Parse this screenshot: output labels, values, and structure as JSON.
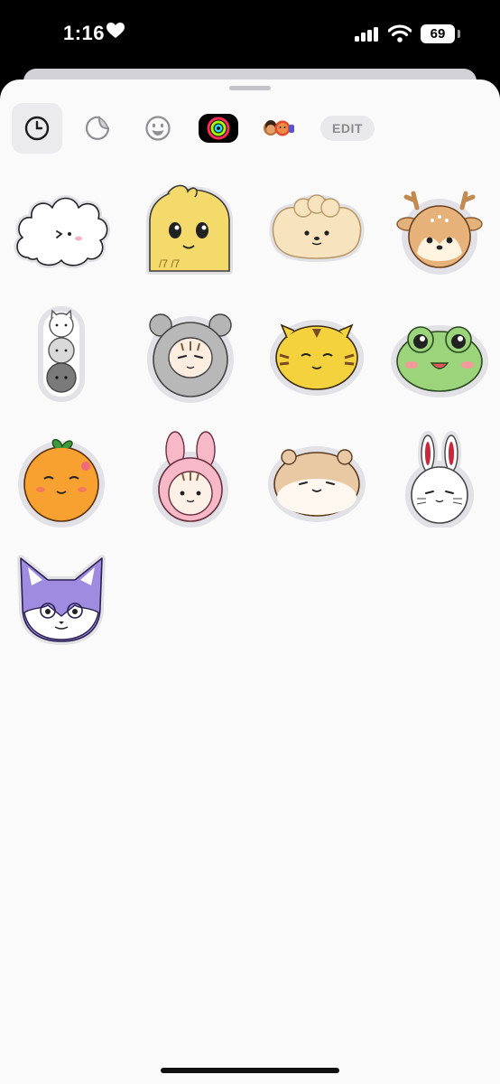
{
  "status_bar": {
    "time": "1:16",
    "battery": "69"
  },
  "toolbar": {
    "edit_label": "EDIT"
  },
  "tabs": [
    {
      "name": "recents-tab",
      "icon": "clock-icon"
    },
    {
      "name": "stickers-tab",
      "icon": "peel-sticker-icon"
    },
    {
      "name": "emoji-tab",
      "icon": "smiley-icon"
    },
    {
      "name": "activity-tab",
      "icon": "activity-rings-icon"
    },
    {
      "name": "memoji-tab",
      "icon": "memoji-icon"
    }
  ],
  "stickers": [
    {
      "name": "cloud-sticker",
      "text": ""
    },
    {
      "name": "yellow-chick-sticker",
      "text": "/7 /7"
    },
    {
      "name": "puppy-sticker",
      "text": ""
    },
    {
      "name": "deer-sticker",
      "text": ""
    },
    {
      "name": "stacked-cats-sticker",
      "text": ""
    },
    {
      "name": "gray-bear-sticker",
      "text": ""
    },
    {
      "name": "tiger-sticker",
      "text": ""
    },
    {
      "name": "frog-sticker",
      "text": ""
    },
    {
      "name": "orange-sticker",
      "text": ""
    },
    {
      "name": "bunny-hood-sticker",
      "text": ""
    },
    {
      "name": "hamster-sticker",
      "text": ""
    },
    {
      "name": "white-rabbit-sticker",
      "text": ""
    },
    {
      "name": "fox-sticker",
      "text": ""
    }
  ]
}
